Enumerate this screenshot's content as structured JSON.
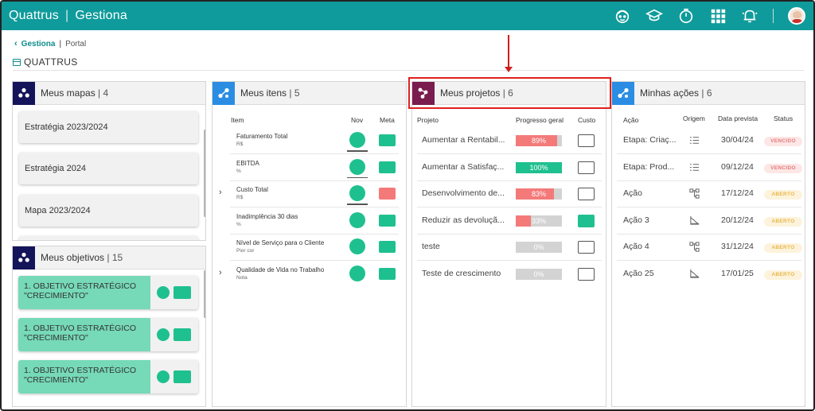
{
  "app": {
    "brand": "Quattrus",
    "product": "Gestiona"
  },
  "breadcrumb": {
    "link": "Gestiona",
    "current": "Portal"
  },
  "page": {
    "title": "QUATTRUS"
  },
  "topbar_icons": [
    "support-icon",
    "graduation-cap-icon",
    "timer-icon",
    "apps-grid-icon",
    "notification-bell-icon"
  ],
  "colors": {
    "primary": "#0f9b9b",
    "navy": "#14145a",
    "blue": "#2a8de3",
    "magenta": "#7a1c4e",
    "green": "#1fc08f",
    "red": "#f47a7a",
    "highlight": "#e02020"
  },
  "mapas": {
    "title": "Meus mapas",
    "count": "4",
    "items": [
      "Estratégia 2023/2024",
      "Estratégia 2024",
      "Mapa 2023/2024"
    ]
  },
  "objetivos": {
    "title": "Meus objetivos",
    "count": "15",
    "items": [
      {
        "label": "1. OBJETIVO ESTRATÉGICO \"CRECIMIENTO\""
      },
      {
        "label": "1. OBJETIVO ESTRATÉGICO \"CRECIMIENTO\""
      },
      {
        "label": "1. OBJETIVO ESTRATÉGICO \"CRECIMIENTO\""
      }
    ]
  },
  "itens": {
    "title": "Meus itens",
    "count": "5",
    "columns": {
      "item": "Item",
      "nov": "Nov",
      "meta": "Meta"
    },
    "rows": [
      {
        "name": "Faturamento Total",
        "unit": "R$",
        "expandable": false,
        "meta": "green"
      },
      {
        "name": "EBITDA",
        "unit": "%",
        "expandable": false,
        "meta": "green"
      },
      {
        "name": "Custo Total",
        "unit": "R$",
        "expandable": true,
        "meta": "red"
      },
      {
        "name": "Inadimplência 30 dias",
        "unit": "%",
        "expandable": false,
        "meta": "green"
      },
      {
        "name": "Nível de Serviço para o Cliente",
        "unit": "Pior cor",
        "expandable": false,
        "meta": "green"
      },
      {
        "name": "Qualidade de Vida no Trabalho",
        "unit": "Nota",
        "expandable": true,
        "meta": "green"
      }
    ]
  },
  "projetos": {
    "title": "Meus projetos",
    "count": "6",
    "columns": {
      "projeto": "Projeto",
      "progresso": "Progresso geral",
      "custo": "Custo"
    },
    "rows": [
      {
        "name": "Aumentar a Rentabil...",
        "progress": 89,
        "progress_label": "89%",
        "color": "red",
        "cost": "empty"
      },
      {
        "name": "Aumentar a Satisfaç...",
        "progress": 100,
        "progress_label": "100%",
        "color": "green",
        "cost": "empty"
      },
      {
        "name": "Desenvolvimento de...",
        "progress": 83,
        "progress_label": "83%",
        "color": "red",
        "cost": "empty"
      },
      {
        "name": "Reduzir as devoluçã...",
        "progress": 33,
        "progress_label": "33%",
        "color": "red",
        "cost": "green"
      },
      {
        "name": "teste",
        "progress": 0,
        "progress_label": "0%",
        "color": "gray",
        "cost": "empty"
      },
      {
        "name": "Teste de crescimento",
        "progress": 0,
        "progress_label": "0%",
        "color": "gray",
        "cost": "empty"
      }
    ]
  },
  "acoes": {
    "title": "Minhas ações",
    "count": "6",
    "columns": {
      "acao": "Ação",
      "origem": "Origem",
      "data": "Data prevista",
      "status": "Status"
    },
    "rows": [
      {
        "name": "Etapa: Criaç...",
        "origin": "list-icon",
        "date": "30/04/24",
        "status": "VENCIDO",
        "status_kind": "vencido"
      },
      {
        "name": "Etapa: Prod...",
        "origin": "list-icon",
        "date": "09/12/24",
        "status": "VENCIDO",
        "status_kind": "vencido"
      },
      {
        "name": "Ação",
        "origin": "hierarchy-icon",
        "date": "17/12/24",
        "status": "ABERTO",
        "status_kind": "aberto"
      },
      {
        "name": "Ação 3",
        "origin": "chart-icon",
        "date": "20/12/24",
        "status": "ABERTO",
        "status_kind": "aberto"
      },
      {
        "name": "Ação 4",
        "origin": "hierarchy-icon",
        "date": "31/12/24",
        "status": "ABERTO",
        "status_kind": "aberto"
      },
      {
        "name": "Ação 25",
        "origin": "chart-icon",
        "date": "17/01/25",
        "status": "ABERTO",
        "status_kind": "aberto"
      }
    ]
  }
}
